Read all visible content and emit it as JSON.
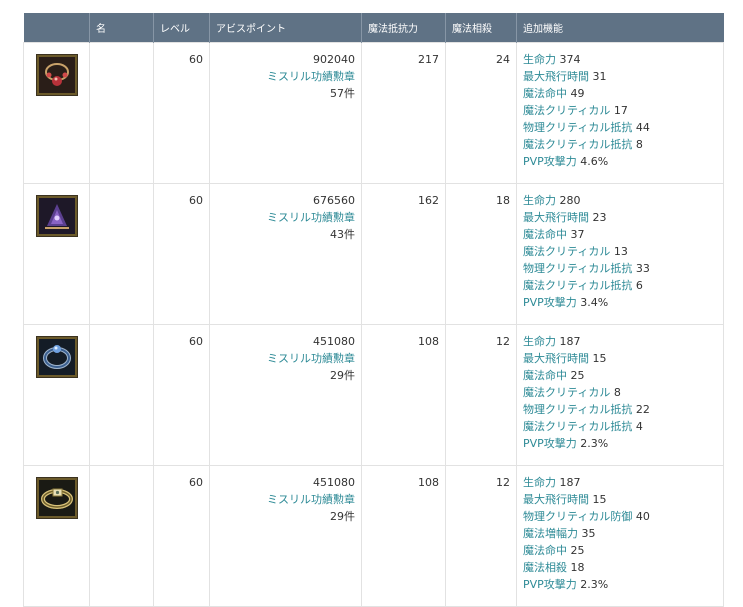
{
  "table": {
    "headers": {
      "icon": "",
      "name": "名",
      "level": "レベル",
      "abyss_points": "アビスポイント",
      "magic_resist": "魔法抵抗力",
      "magic_def": "魔法相殺",
      "extra": "追加機能"
    },
    "rows": [
      {
        "icon": "necklace-red-icon",
        "name": "",
        "level": "60",
        "ap": "902040",
        "medal": "ミスリル功績勲章",
        "medal_count": "57件",
        "magic_resist": "217",
        "magic_def": "24",
        "stats": [
          {
            "name": "生命力",
            "value": "374"
          },
          {
            "name": "最大飛行時間",
            "value": "31"
          },
          {
            "name": "魔法命中",
            "value": "49"
          },
          {
            "name": "魔法クリティカル",
            "value": "17"
          },
          {
            "name": "物理クリティカル抵抗",
            "value": "44"
          },
          {
            "name": "魔法クリティカル抵抗",
            "value": "8"
          },
          {
            "name": "PVP攻撃力",
            "value": "4.6%"
          }
        ]
      },
      {
        "icon": "earring-purple-icon",
        "name": "",
        "level": "60",
        "ap": "676560",
        "medal": "ミスリル功績勲章",
        "medal_count": "43件",
        "magic_resist": "162",
        "magic_def": "18",
        "stats": [
          {
            "name": "生命力",
            "value": "280"
          },
          {
            "name": "最大飛行時間",
            "value": "23"
          },
          {
            "name": "魔法命中",
            "value": "37"
          },
          {
            "name": "魔法クリティカル",
            "value": "13"
          },
          {
            "name": "物理クリティカル抵抗",
            "value": "33"
          },
          {
            "name": "魔法クリティカル抵抗",
            "value": "6"
          },
          {
            "name": "PVP攻撃力",
            "value": "3.4%"
          }
        ]
      },
      {
        "icon": "ring-blue-icon",
        "name": "",
        "level": "60",
        "ap": "451080",
        "medal": "ミスリル功績勲章",
        "medal_count": "29件",
        "magic_resist": "108",
        "magic_def": "12",
        "stats": [
          {
            "name": "生命力",
            "value": "187"
          },
          {
            "name": "最大飛行時間",
            "value": "15"
          },
          {
            "name": "魔法命中",
            "value": "25"
          },
          {
            "name": "魔法クリティカル",
            "value": "8"
          },
          {
            "name": "物理クリティカル抵抗",
            "value": "22"
          },
          {
            "name": "魔法クリティカル抵抗",
            "value": "4"
          },
          {
            "name": "PVP攻撃力",
            "value": "2.3%"
          }
        ]
      },
      {
        "icon": "belt-gold-icon",
        "name": "",
        "level": "60",
        "ap": "451080",
        "medal": "ミスリル功績勲章",
        "medal_count": "29件",
        "magic_resist": "108",
        "magic_def": "12",
        "stats": [
          {
            "name": "生命力",
            "value": "187"
          },
          {
            "name": "最大飛行時間",
            "value": "15"
          },
          {
            "name": "物理クリティカル防御",
            "value": "40"
          },
          {
            "name": "魔法増幅力",
            "value": "35"
          },
          {
            "name": "魔法命中",
            "value": "25"
          },
          {
            "name": "魔法相殺",
            "value": "18"
          },
          {
            "name": "PVP攻撃力",
            "value": "2.3%"
          }
        ]
      }
    ]
  }
}
